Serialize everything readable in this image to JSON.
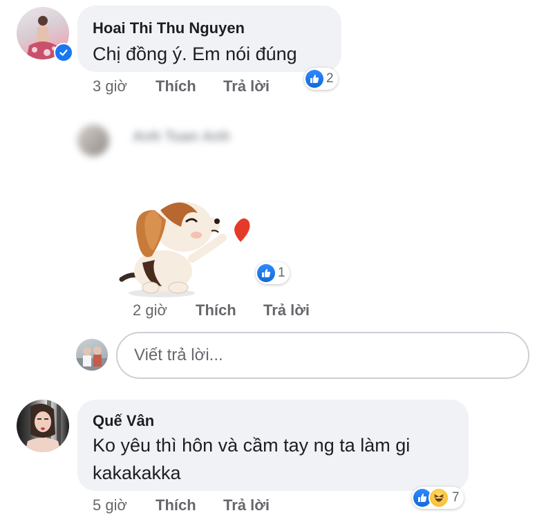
{
  "comments": [
    {
      "author": "Hoai Thi Thu Nguyen",
      "text": "Chị đồng ý. Em nói đúng",
      "time": "3 giờ",
      "like_label": "Thích",
      "reply_label": "Trả lời",
      "reaction_count": "2",
      "reactions": [
        "like-icon"
      ],
      "verified": true
    },
    {
      "author": "Anh Tuan Anh",
      "sticker": "puppy-kiss-heart-sticker",
      "time": "2 giờ",
      "like_label": "Thích",
      "reply_label": "Trả lời",
      "reaction_count": "1",
      "reactions": [
        "like-icon"
      ]
    },
    {
      "author": "Quế Vân",
      "text_line1": "Ko yêu thì hôn và cầm tay ng ta làm gi",
      "text_line2": "kakakakka",
      "time": "5 giờ",
      "like_label": "Thích",
      "reply_label": "Trả lời",
      "reaction_count": "7",
      "reactions": [
        "like-icon",
        "haha-icon"
      ]
    }
  ],
  "reply_box": {
    "placeholder": "Viết trả lời..."
  },
  "colors": {
    "like_blue": "#1877f2",
    "bubble": "#f0f2f5",
    "meta": "#65676b",
    "verified_badge": "#1877f2"
  }
}
